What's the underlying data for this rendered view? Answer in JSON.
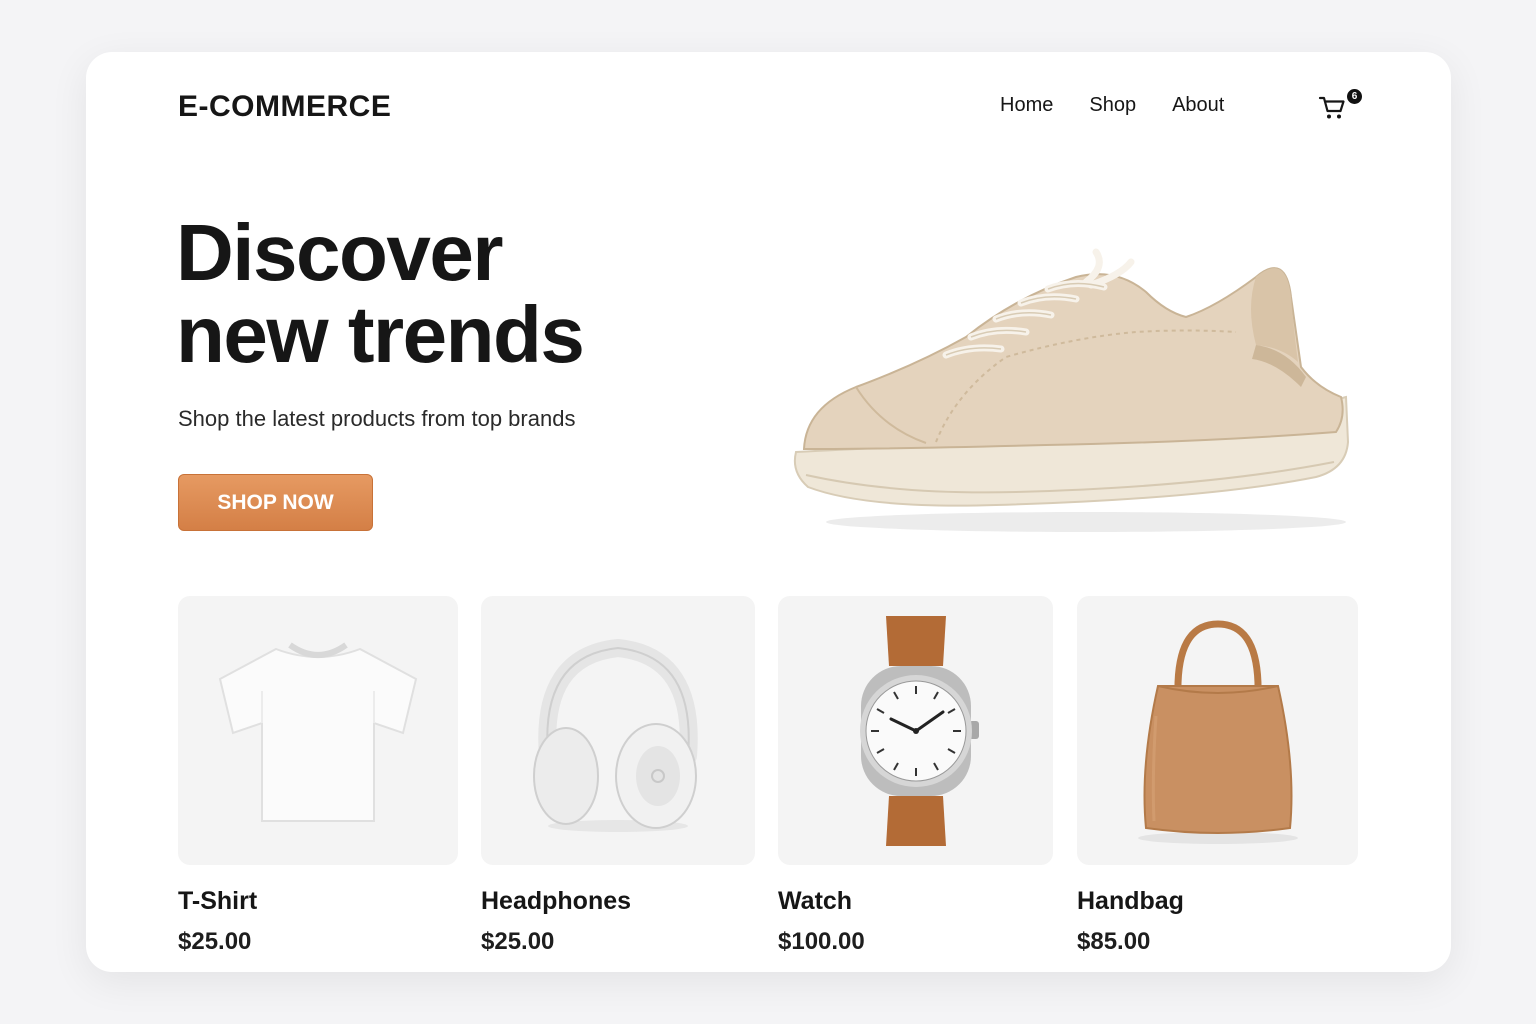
{
  "header": {
    "logo": "E-COMMERCE",
    "nav": [
      {
        "label": "Home"
      },
      {
        "label": "Shop"
      },
      {
        "label": "About"
      }
    ],
    "cart": {
      "icon": "cart-icon",
      "count": "6"
    }
  },
  "hero": {
    "title_line1": "Discover",
    "title_line2": "new trends",
    "subtitle": "Shop the latest products from top brands",
    "cta_label": "SHOP NOW",
    "image": "sneaker-image"
  },
  "products": [
    {
      "name": "T-Shirt",
      "price": "$25.00",
      "image": "tshirt-image"
    },
    {
      "name": "Headphones",
      "price": "$25.00",
      "image": "headphones-image"
    },
    {
      "name": "Watch",
      "price": "$100.00",
      "image": "watch-image"
    },
    {
      "name": "Handbag",
      "price": "$85.00",
      "image": "handbag-image"
    }
  ],
  "colors": {
    "accent": "#d98a50",
    "text": "#161616",
    "card_bg": "#ffffff",
    "thumb_bg": "#f4f4f4"
  }
}
